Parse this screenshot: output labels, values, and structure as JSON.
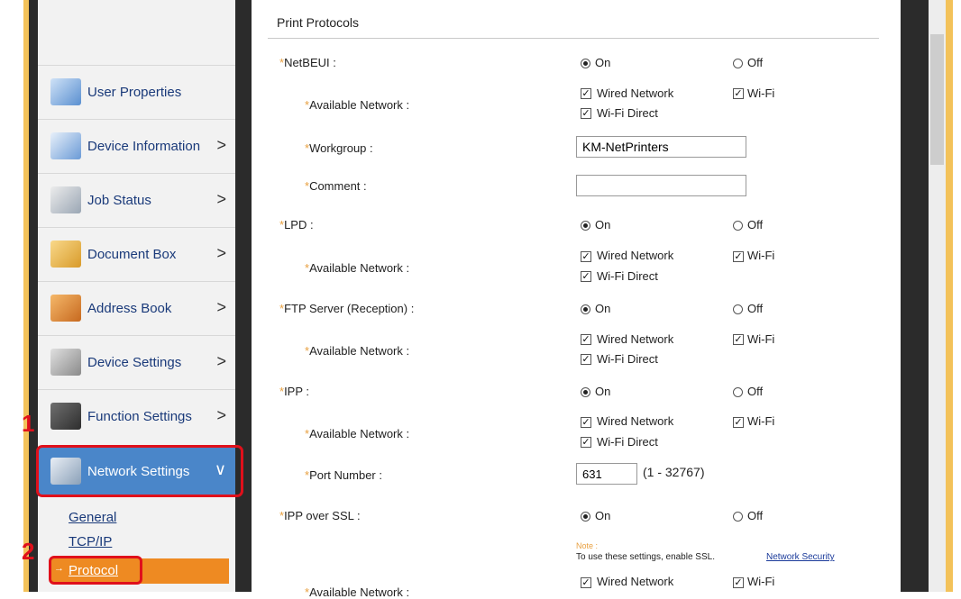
{
  "sidebar": {
    "items": [
      {
        "label": "User Properties",
        "icon": "user-properties-icon",
        "chevron": ""
      },
      {
        "label": "Device Information",
        "icon": "device-information-icon",
        "chevron": ">"
      },
      {
        "label": "Job Status",
        "icon": "job-status-icon",
        "chevron": ">"
      },
      {
        "label": "Document Box",
        "icon": "document-box-icon",
        "chevron": ">"
      },
      {
        "label": "Address Book",
        "icon": "address-book-icon",
        "chevron": ">"
      },
      {
        "label": "Device Settings",
        "icon": "device-settings-icon",
        "chevron": ">"
      },
      {
        "label": "Function Settings",
        "icon": "function-settings-icon",
        "chevron": ">"
      }
    ],
    "network": {
      "label": "Network Settings",
      "chevron": "∨"
    },
    "sub_links": [
      "General",
      "TCP/IP",
      "Protocol"
    ],
    "callouts": [
      "1",
      "2"
    ]
  },
  "content": {
    "section_title": "Print Protocols",
    "star": "*",
    "on": "On",
    "off": "Off",
    "wired": "Wired Network",
    "wifi": "Wi-Fi",
    "wifi_direct": "Wi-Fi Direct",
    "netbeui": {
      "label": "NetBEUI :",
      "avail": "Available Network :",
      "workgroup_label": "Workgroup :",
      "workgroup_value": "KM-NetPrinters",
      "comment_label": "Comment :",
      "comment_value": ""
    },
    "lpd": {
      "label": "LPD :",
      "avail": "Available Network :"
    },
    "ftp": {
      "label": "FTP Server (Reception) :",
      "avail": "Available Network :"
    },
    "ipp": {
      "label": "IPP :",
      "avail": "Available Network :",
      "port_label": "Port Number :",
      "port_value": "631",
      "port_range": "(1 - 32767)"
    },
    "ippssl": {
      "label": "IPP over SSL :",
      "note_title": "Note :",
      "note_text": "To use these settings, enable SSL.",
      "note_link": "Network Security",
      "avail": "Available Network :"
    }
  },
  "colors": {
    "accent_blue": "#4a86c9",
    "orange": "#ee8a22",
    "callout_red": "#e0101b",
    "star_orange": "#e8a040"
  }
}
